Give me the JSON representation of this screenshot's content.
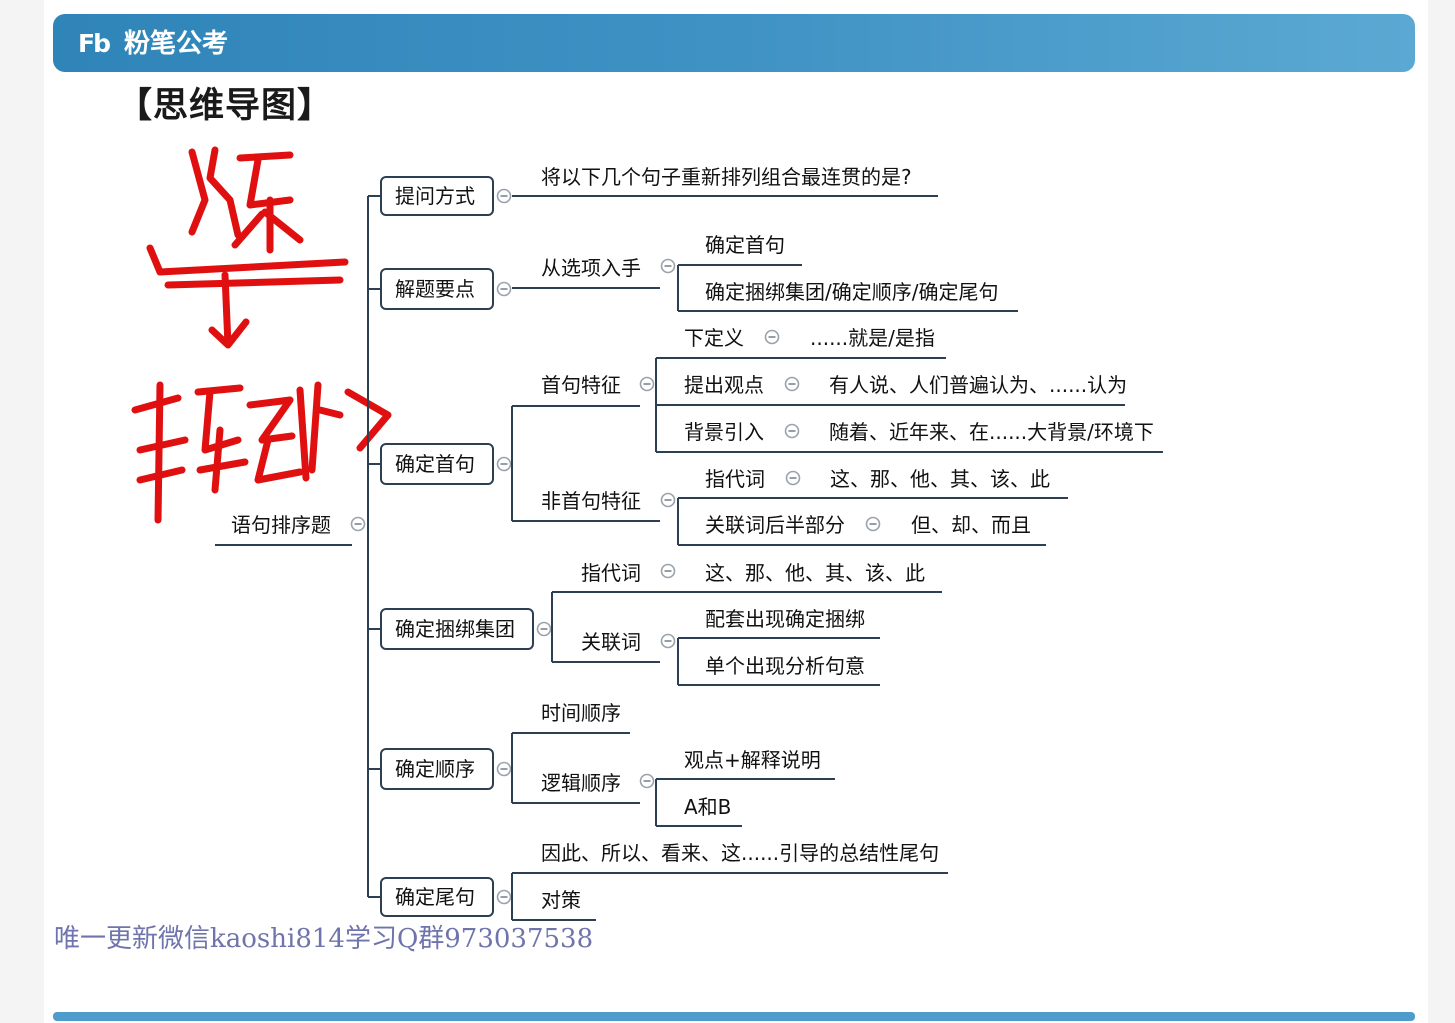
{
  "header": {
    "logo_mark": "Fb",
    "brand": "粉笔公考",
    "colors": {
      "bar": "#3f92c4",
      "text": "#ffffff"
    }
  },
  "title": "【思维导图】",
  "annotation": {
    "kind": "handwritten red ink note",
    "color": "#e01010"
  },
  "mindmap": {
    "root": "语句排序题",
    "branches": [
      {
        "label": "提问方式",
        "children": [
          {
            "label": "将以下几个句子重新排列组合最连贯的是?"
          }
        ]
      },
      {
        "label": "解题要点",
        "children": [
          {
            "label": "从选项入手",
            "children": [
              {
                "label": "确定首句"
              },
              {
                "label": "确定捆绑集团/确定顺序/确定尾句"
              }
            ]
          }
        ]
      },
      {
        "label": "确定首句",
        "children": [
          {
            "label": "首句特征",
            "children": [
              {
                "label": "下定义",
                "children": [
                  {
                    "label": "......就是/是指"
                  }
                ]
              },
              {
                "label": "提出观点",
                "children": [
                  {
                    "label": "有人说、人们普遍认为、......认为"
                  }
                ]
              },
              {
                "label": "背景引入",
                "children": [
                  {
                    "label": "随着、近年来、在......大背景/环境下"
                  }
                ]
              }
            ]
          },
          {
            "label": "非首句特征",
            "children": [
              {
                "label": "指代词",
                "children": [
                  {
                    "label": "这、那、他、其、该、此"
                  }
                ]
              },
              {
                "label": "关联词后半部分",
                "children": [
                  {
                    "label": "但、却、而且"
                  }
                ]
              }
            ]
          }
        ]
      },
      {
        "label": "确定捆绑集团",
        "children": [
          {
            "label": "指代词",
            "children": [
              {
                "label": "这、那、他、其、该、此"
              }
            ]
          },
          {
            "label": "关联词",
            "children": [
              {
                "label": "配套出现确定捆绑"
              },
              {
                "label": "单个出现分析句意"
              }
            ]
          }
        ]
      },
      {
        "label": "确定顺序",
        "children": [
          {
            "label": "时间顺序"
          },
          {
            "label": "逻辑顺序",
            "children": [
              {
                "label": "观点+解释说明"
              },
              {
                "label": "A和B"
              }
            ]
          }
        ]
      },
      {
        "label": "确定尾句",
        "children": [
          {
            "label": "因此、所以、看来、这......引导的总结性尾句"
          },
          {
            "label": "对策"
          }
        ]
      }
    ],
    "colors": {
      "line": "#2d3f52",
      "box_border": "#2d3f52",
      "text": "#111111"
    }
  },
  "watermark": "唯一更新微信kaoshi814学习Q群973037538"
}
